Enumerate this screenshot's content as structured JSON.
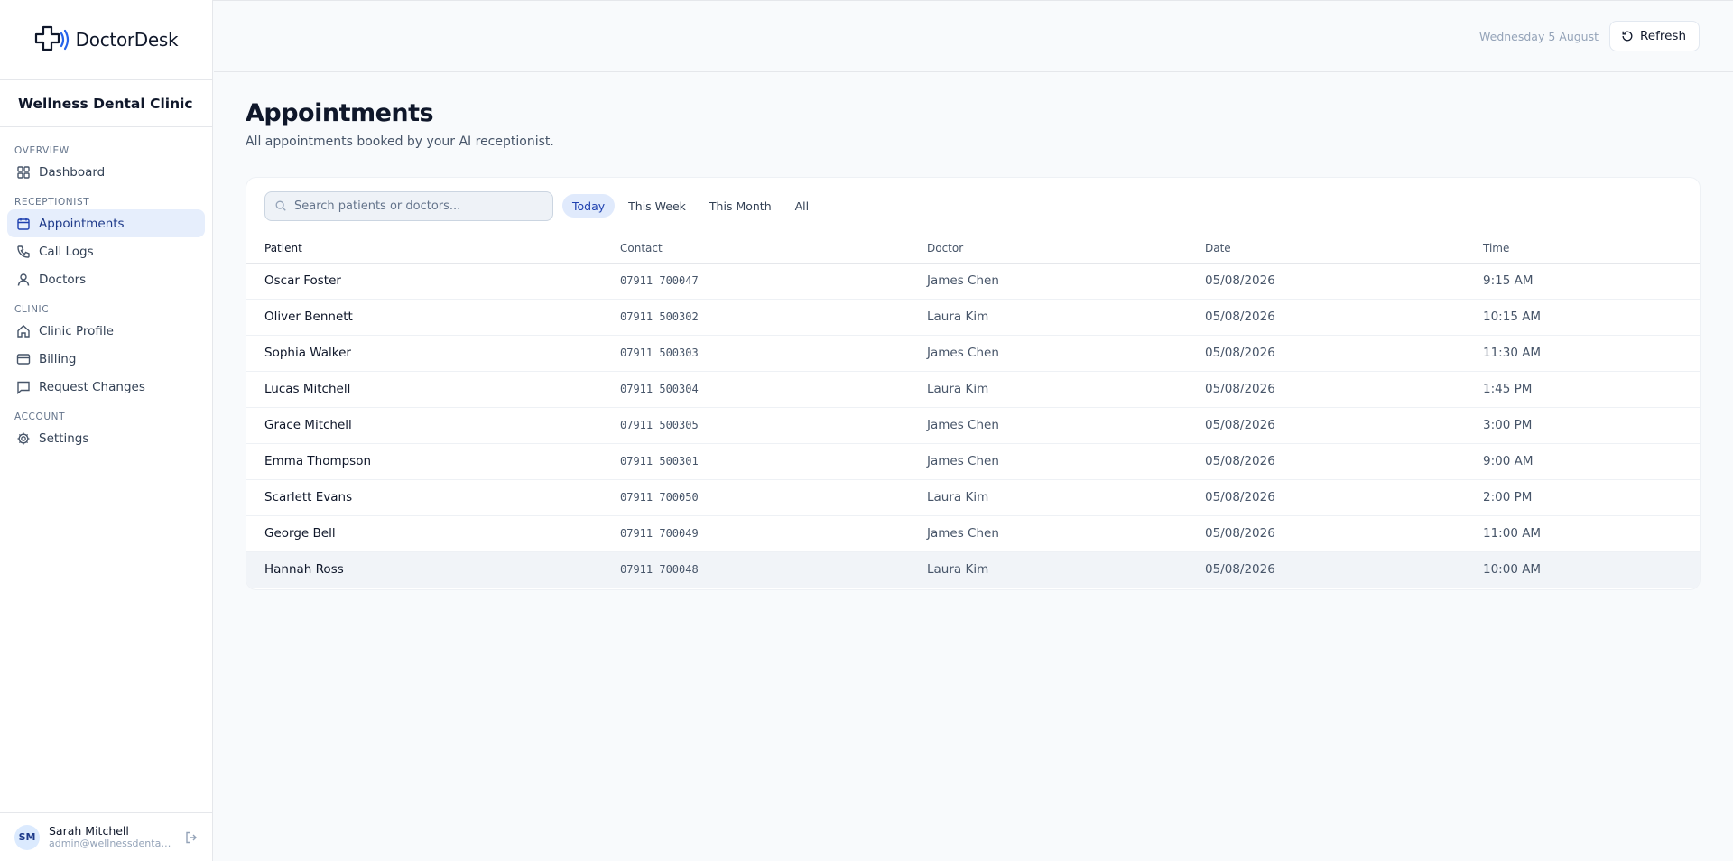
{
  "brand": {
    "name": "DoctorDesk"
  },
  "clinic_name": "Wellness Dental Clinic",
  "nav": {
    "sections": [
      {
        "label": "OVERVIEW",
        "items": [
          {
            "label": "Dashboard",
            "icon": "grid-icon"
          }
        ]
      },
      {
        "label": "RECEPTIONIST",
        "items": [
          {
            "label": "Appointments",
            "icon": "calendar-icon",
            "active": true
          },
          {
            "label": "Call Logs",
            "icon": "phone-icon"
          },
          {
            "label": "Doctors",
            "icon": "user-icon"
          }
        ]
      },
      {
        "label": "CLINIC",
        "items": [
          {
            "label": "Clinic Profile",
            "icon": "home-icon"
          },
          {
            "label": "Billing",
            "icon": "credit-card-icon"
          },
          {
            "label": "Request Changes",
            "icon": "message-icon"
          }
        ]
      },
      {
        "label": "ACCOUNT",
        "items": [
          {
            "label": "Settings",
            "icon": "gear-icon"
          }
        ]
      }
    ]
  },
  "user": {
    "initials": "SM",
    "name": "Sarah Mitchell",
    "email": "admin@wellnessdental.c..."
  },
  "header": {
    "date": "Wednesday 5 August",
    "refresh_label": "Refresh"
  },
  "page": {
    "title": "Appointments",
    "subtitle": "All appointments booked by your AI receptionist."
  },
  "search": {
    "placeholder": "Search patients or doctors..."
  },
  "filters": [
    {
      "label": "Today",
      "active": true
    },
    {
      "label": "This Week"
    },
    {
      "label": "This Month"
    },
    {
      "label": "All"
    }
  ],
  "table": {
    "columns": [
      "Patient",
      "Contact",
      "Doctor",
      "Date",
      "Time"
    ],
    "rows": [
      [
        "Oscar Foster",
        "07911 700047",
        "James Chen",
        "05/08/2026",
        "9:15 AM"
      ],
      [
        "Oliver Bennett",
        "07911 500302",
        "Laura Kim",
        "05/08/2026",
        "10:15 AM"
      ],
      [
        "Sophia Walker",
        "07911 500303",
        "James Chen",
        "05/08/2026",
        "11:30 AM"
      ],
      [
        "Lucas Mitchell",
        "07911 500304",
        "Laura Kim",
        "05/08/2026",
        "1:45 PM"
      ],
      [
        "Grace Mitchell",
        "07911 500305",
        "James Chen",
        "05/08/2026",
        "3:00 PM"
      ],
      [
        "Emma Thompson",
        "07911 500301",
        "James Chen",
        "05/08/2026",
        "9:00 AM"
      ],
      [
        "Scarlett Evans",
        "07911 700050",
        "Laura Kim",
        "05/08/2026",
        "2:00 PM"
      ],
      [
        "George Bell",
        "07911 700049",
        "James Chen",
        "05/08/2026",
        "11:00 AM"
      ],
      [
        "Hannah Ross",
        "07911 700048",
        "Laura Kim",
        "05/08/2026",
        "10:00 AM"
      ]
    ]
  },
  "colors": {
    "accent": "#1e40af",
    "active_bg": "#e6eefc"
  }
}
